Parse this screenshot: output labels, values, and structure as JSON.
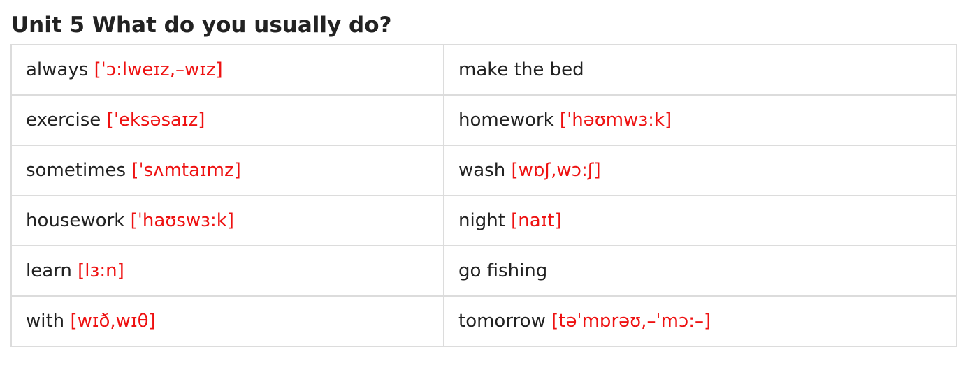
{
  "title": "Unit 5 What do you usually do?",
  "colors": {
    "text": "#222222",
    "phonetic": "#ee1111",
    "border": "#dcdcdc"
  },
  "rows": [
    {
      "left": {
        "word": "always",
        "phonetic": "[ˈɔ:lweɪz,–wɪz]"
      },
      "right": {
        "word": "make the bed",
        "phonetic": ""
      }
    },
    {
      "left": {
        "word": "exercise",
        "phonetic": "[ˈeksəsaɪz]"
      },
      "right": {
        "word": "homework",
        "phonetic": "[ˈhəʊmwɜ:k]"
      }
    },
    {
      "left": {
        "word": "sometimes",
        "phonetic": "[ˈsʌmtaɪmz]"
      },
      "right": {
        "word": "wash",
        "phonetic": "[wɒʃ,wɔ:ʃ]"
      }
    },
    {
      "left": {
        "word": "housework",
        "phonetic": "[ˈhaʊswɜ:k]"
      },
      "right": {
        "word": "night",
        "phonetic": "[naɪt]"
      }
    },
    {
      "left": {
        "word": "learn",
        "phonetic": "[lɜ:n]"
      },
      "right": {
        "word": "go fishing",
        "phonetic": ""
      }
    },
    {
      "left": {
        "word": "with",
        "phonetic": "[wɪð,wɪθ]"
      },
      "right": {
        "word": "tomorrow",
        "phonetic": "[təˈmɒrəʊ,–ˈmɔ:–]"
      }
    }
  ]
}
